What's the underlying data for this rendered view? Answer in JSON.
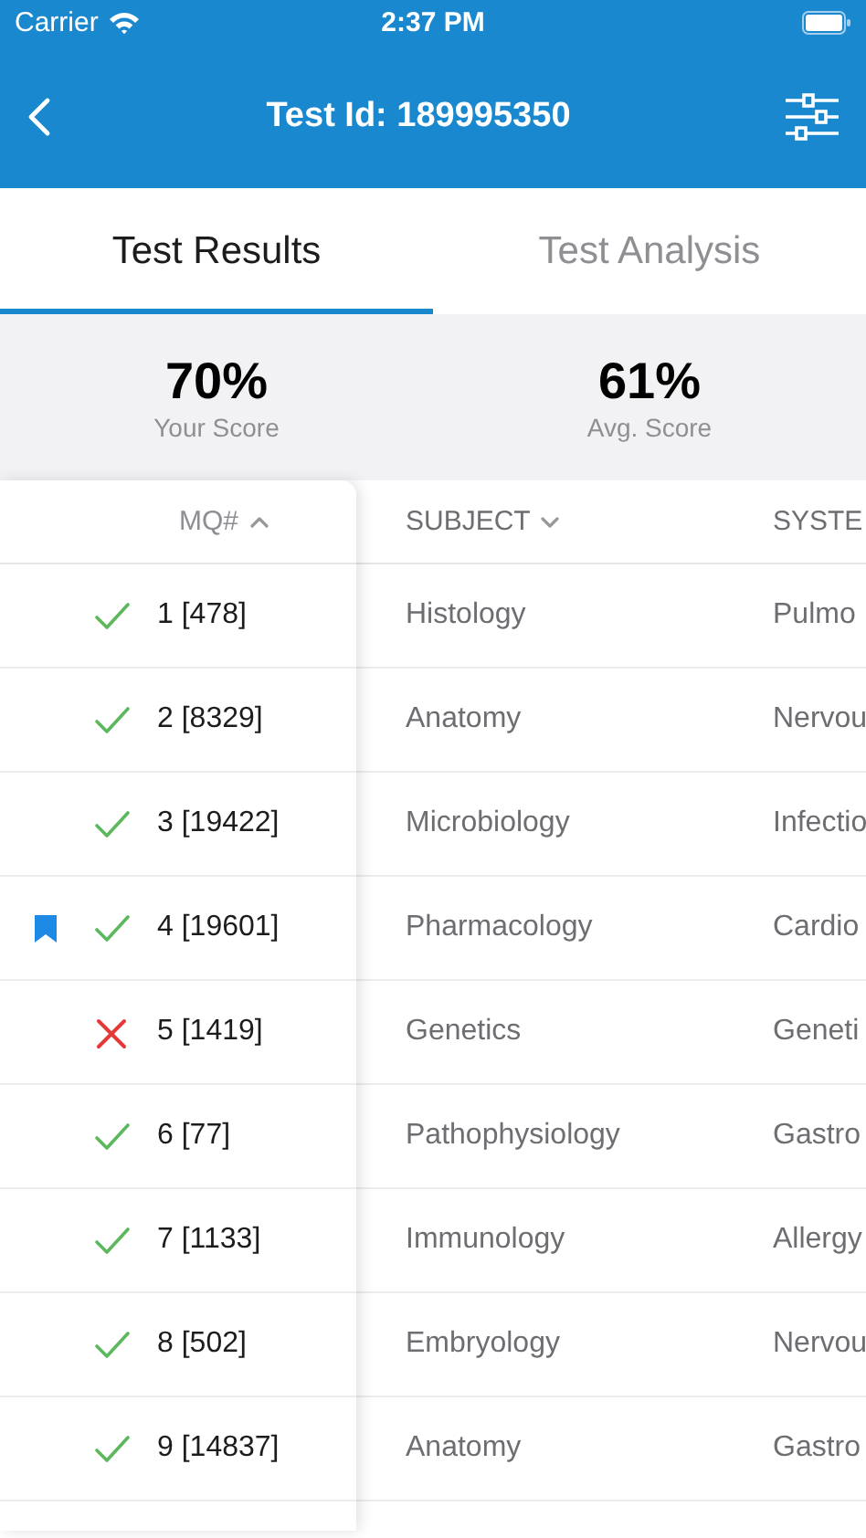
{
  "status_bar": {
    "carrier": "Carrier",
    "time": "2:37 PM"
  },
  "nav": {
    "title": "Test Id: 189995350"
  },
  "tabs": [
    {
      "label": "Test Results",
      "selected": true
    },
    {
      "label": "Test Analysis",
      "selected": false
    }
  ],
  "scores": [
    {
      "value": "70%",
      "label": "Your Score"
    },
    {
      "value": "61%",
      "label": "Avg. Score"
    }
  ],
  "table": {
    "columns": [
      {
        "label": "MQ#",
        "kind": "ascending"
      },
      {
        "label": "SUBJECT",
        "kind": "descending"
      },
      {
        "label": "SYSTE",
        "kind": "plain"
      }
    ],
    "rows": [
      {
        "bookmarked": false,
        "kind": "correct",
        "mq": "1 [478]",
        "subject": "Histology",
        "system": "Pulmo"
      },
      {
        "bookmarked": false,
        "kind": "correct",
        "mq": "2 [8329]",
        "subject": "Anatomy",
        "system": "Nervou"
      },
      {
        "bookmarked": false,
        "kind": "correct",
        "mq": "3 [19422]",
        "subject": "Microbiology",
        "system": "Infectio"
      },
      {
        "bookmarked": true,
        "kind": "correct",
        "mq": "4 [19601]",
        "subject": "Pharmacology",
        "system": "Cardio"
      },
      {
        "bookmarked": false,
        "kind": "incorrect",
        "mq": "5 [1419]",
        "subject": "Genetics",
        "system": "Geneti"
      },
      {
        "bookmarked": false,
        "kind": "correct",
        "mq": "6 [77]",
        "subject": "Pathophysiology",
        "system": "Gastro"
      },
      {
        "bookmarked": false,
        "kind": "correct",
        "mq": "7 [1133]",
        "subject": "Immunology",
        "system": "Allergy"
      },
      {
        "bookmarked": false,
        "kind": "correct",
        "mq": "8 [502]",
        "subject": "Embryology",
        "system": "Nervou"
      },
      {
        "bookmarked": false,
        "kind": "correct",
        "mq": "9 [14837]",
        "subject": "Anatomy",
        "system": "Gastro"
      }
    ]
  }
}
